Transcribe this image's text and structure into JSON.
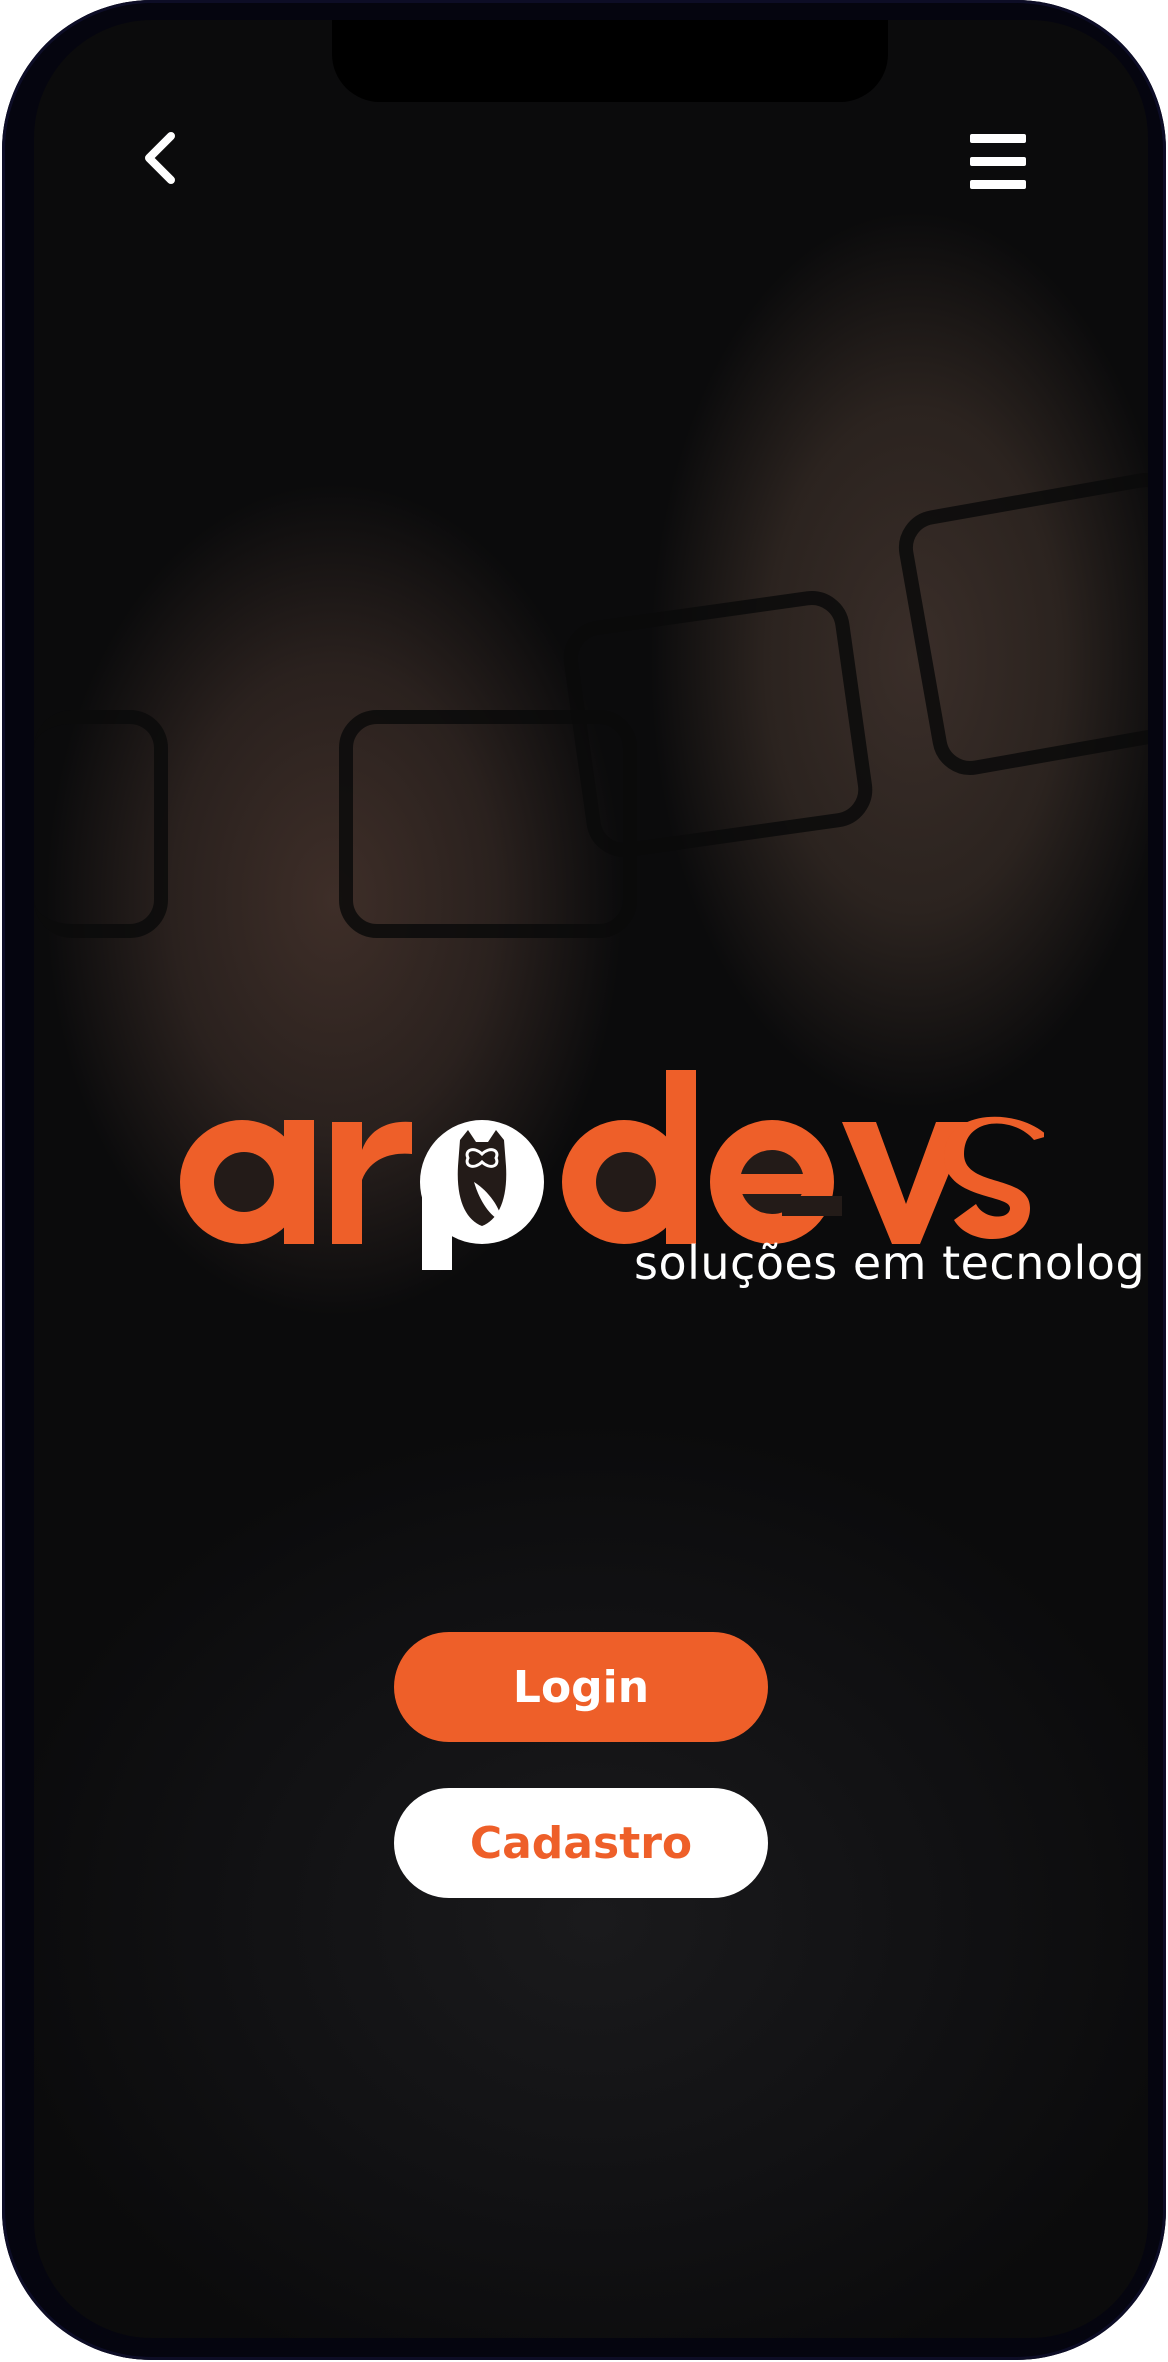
{
  "brand": {
    "name": "arodevs",
    "tagline": "soluções em tecnologia",
    "accent_color": "#ee5f29",
    "text_color": "#ffffff"
  },
  "header": {
    "back_icon": "chevron-left-icon",
    "menu_icon": "hamburger-menu-icon"
  },
  "actions": {
    "login_label": "Login",
    "signup_label": "Cadastro"
  },
  "background": {
    "image": "photo-two-people-smiling-with-glasses"
  }
}
